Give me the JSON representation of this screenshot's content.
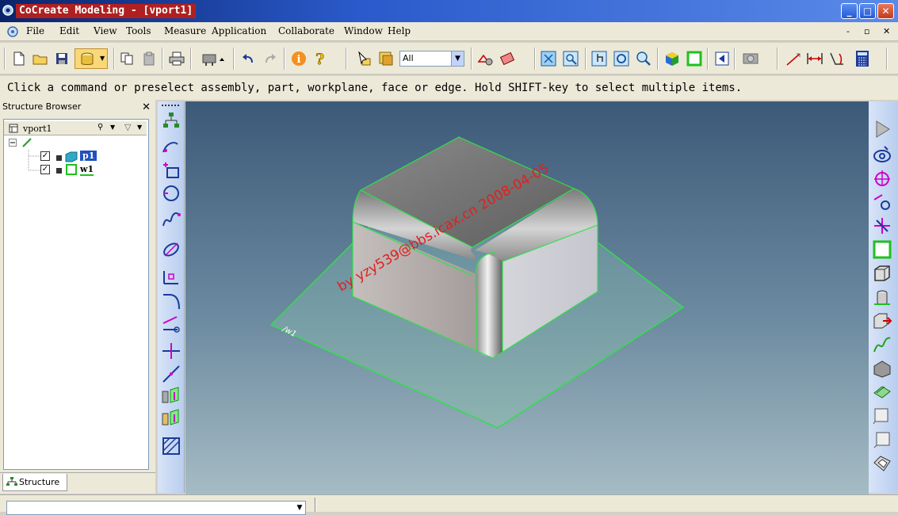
{
  "window": {
    "title": "CoCreate Modeling - [vport1]",
    "buttons": {
      "minimize": "_",
      "maximize": "□",
      "close": "✕"
    }
  },
  "menu": {
    "items": [
      {
        "label": "File",
        "key": "F"
      },
      {
        "label": "Edit",
        "key": "E"
      },
      {
        "label": "View",
        "key": "V"
      },
      {
        "label": "Tools",
        "key": "T"
      },
      {
        "label": "Measure",
        "key": "M"
      },
      {
        "label": "Application",
        "key": "A"
      },
      {
        "label": "Collaborate",
        "key": "C"
      },
      {
        "label": "Window",
        "key": "W"
      },
      {
        "label": "Help",
        "key": "H"
      }
    ],
    "mdi": {
      "minimize": "-",
      "restore": "▫",
      "close": "✕"
    }
  },
  "toolbar": {
    "filter_value": "All"
  },
  "prompt": "Click a command or preselect assembly, part, workplane, face or edge. Hold SHIFT-key to select multiple items.",
  "structure_browser": {
    "title": "Structure Browser",
    "viewport_name": "vport1",
    "items": [
      {
        "label": "p1"
      },
      {
        "label": "w1"
      }
    ],
    "tab_label": "Structure"
  },
  "viewport": {
    "workplane_label": "/w1",
    "watermark": "by yzy539@bbs.icax.cn 2008-04-05",
    "colors": {
      "edge": "#2fe04a",
      "watermark": "#e02020"
    }
  }
}
